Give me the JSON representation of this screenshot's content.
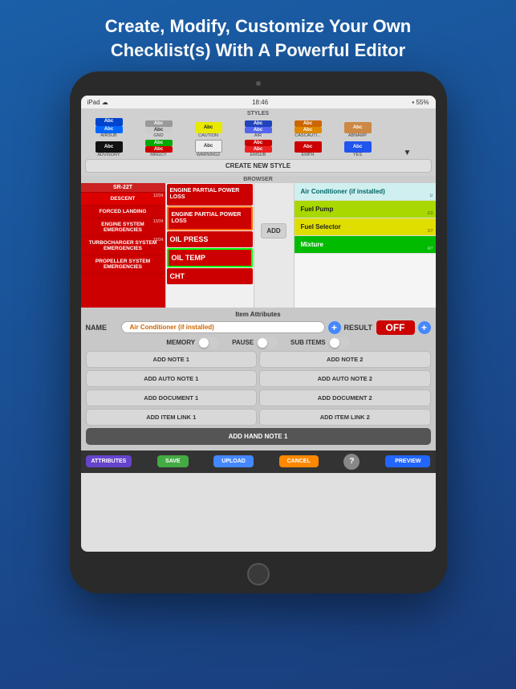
{
  "header": {
    "line1": "Create, Modify, Customize Your Own",
    "line2": "Checklist(s) With A Powerful Editor"
  },
  "statusBar": {
    "left": "iPad ☁",
    "center": "18:46",
    "right": "▪ 55%"
  },
  "stylesLabel": "STYLES",
  "styles": [
    {
      "label": "Abc\nAbc",
      "name": "AIRSUB",
      "bg": "#0044cc",
      "color": "white",
      "bg2": "#0066ff"
    },
    {
      "label": "Abc\nAbc",
      "name": "GND",
      "bg": "#888888",
      "color": "white",
      "bg2": "#bbbbbb"
    },
    {
      "label": "Abc",
      "name": "CAUTION",
      "bg": "#dddd00",
      "color": "#222"
    },
    {
      "label": "Abc\nAbc",
      "name": "AIR",
      "bg": "#3333cc",
      "color": "white"
    },
    {
      "label": "Abc\nAbc",
      "name": "CASCAUTI...",
      "bg": "#cc6600",
      "color": "white"
    },
    {
      "label": "Abc",
      "name": "ABNAMP",
      "bg": "#aa6600",
      "color": "white"
    },
    {
      "label": "",
      "name": "",
      "bg": "transparent",
      "color": "transparent"
    }
  ],
  "styles2": [
    {
      "label": "Abc",
      "name": "ADVISORY",
      "bg": "#222",
      "color": "white"
    },
    {
      "label": "Abc\nAbc",
      "name": "MRGCY",
      "bg": "#00aa00",
      "color": "white",
      "bg2": "#cc0000"
    },
    {
      "label": "Abc",
      "name": "WARNING2",
      "bg": "#eeeeee",
      "color": "#333",
      "border": "#333"
    },
    {
      "label": "Abc\nAbc",
      "name": "EMSUB",
      "bg": "#cc0000",
      "color": "white"
    },
    {
      "label": "Abc",
      "name": "EMPH",
      "bg": "#cc0000",
      "color": "white"
    },
    {
      "label": "Abc",
      "name": "YES",
      "bg": "#2255ee",
      "color": "white"
    },
    {
      "label": "▼",
      "name": "",
      "bg": "transparent",
      "color": "#333"
    }
  ],
  "createStyleBtn": "CREATE NEW STYLE",
  "browserLabel": "BROWSER",
  "checklistHeader": "SR-22T",
  "checklistItems": [
    {
      "text": "DESCENT",
      "pages": "12/34"
    },
    {
      "text": "FORCED LANDING",
      "pages": ""
    },
    {
      "text": "ENGINE SYSTEM EMERGENCIES",
      "pages": "13/34"
    },
    {
      "text": "TURBOCHARGER SYSTEM EMERGENCIES",
      "pages": "15/34"
    },
    {
      "text": "PROPELLER SYSTEM EMERGENCIES",
      "pages": ""
    }
  ],
  "engineItems": [
    {
      "text": "ENGINE PARTIAL POWER LOSS",
      "outlined": false
    },
    {
      "text": "ENGINE PARTIAL POWER LOSS",
      "outlined": true
    }
  ],
  "oilItems": [
    {
      "text": "OIL PRESS"
    },
    {
      "text": "OIL TEMP",
      "selected": true
    },
    {
      "text": "CHT"
    }
  ],
  "addBtn": "ADD",
  "rightItems": [
    {
      "text": "Air Conditioner (if installed)",
      "style": "cyan",
      "pages": "1/"
    },
    {
      "text": "Fuel Pump",
      "style": "yellow-green",
      "pages": "2/2"
    },
    {
      "text": "Fuel Selector",
      "style": "yellow",
      "pages": "3/7"
    },
    {
      "text": "Mixture",
      "style": "green",
      "pages": "4/7"
    }
  ],
  "attributesTitle": "Item Attributes",
  "nameLabel": "NAME",
  "nameValue": "Air Conditioner (if installed)",
  "resultLabel": "RESULT",
  "resultValue": "OFF",
  "memoryLabel": "MEMORY",
  "pauseLabel": "PAUSE",
  "subItemsLabel": "SUB ITEMS",
  "actionButtons": [
    {
      "text": "ADD NOTE 1",
      "key": "add-note-1"
    },
    {
      "text": "ADD NOTE 2",
      "key": "add-note-2"
    },
    {
      "text": "ADD AUTO NOTE 1",
      "key": "add-auto-note-1"
    },
    {
      "text": "ADD AUTO NOTE 2",
      "key": "add-auto-note-2"
    },
    {
      "text": "ADD DOCUMENT 1",
      "key": "add-doc-1"
    },
    {
      "text": "ADD DOCUMENT 2",
      "key": "add-doc-2"
    },
    {
      "text": "ADD ITEM LINK 1",
      "key": "add-item-link-1"
    },
    {
      "text": "ADD ITEM LINK 2",
      "key": "add-item-link-2"
    }
  ],
  "handNoteBtn": "ADD HAND NOTE 1",
  "toolbar": {
    "attributes": "ATTRIBUTES",
    "save": "SAVE",
    "upload": "UPLOAD",
    "cancel": "CANCEL",
    "question": "?",
    "preview": "PREVIEW"
  }
}
